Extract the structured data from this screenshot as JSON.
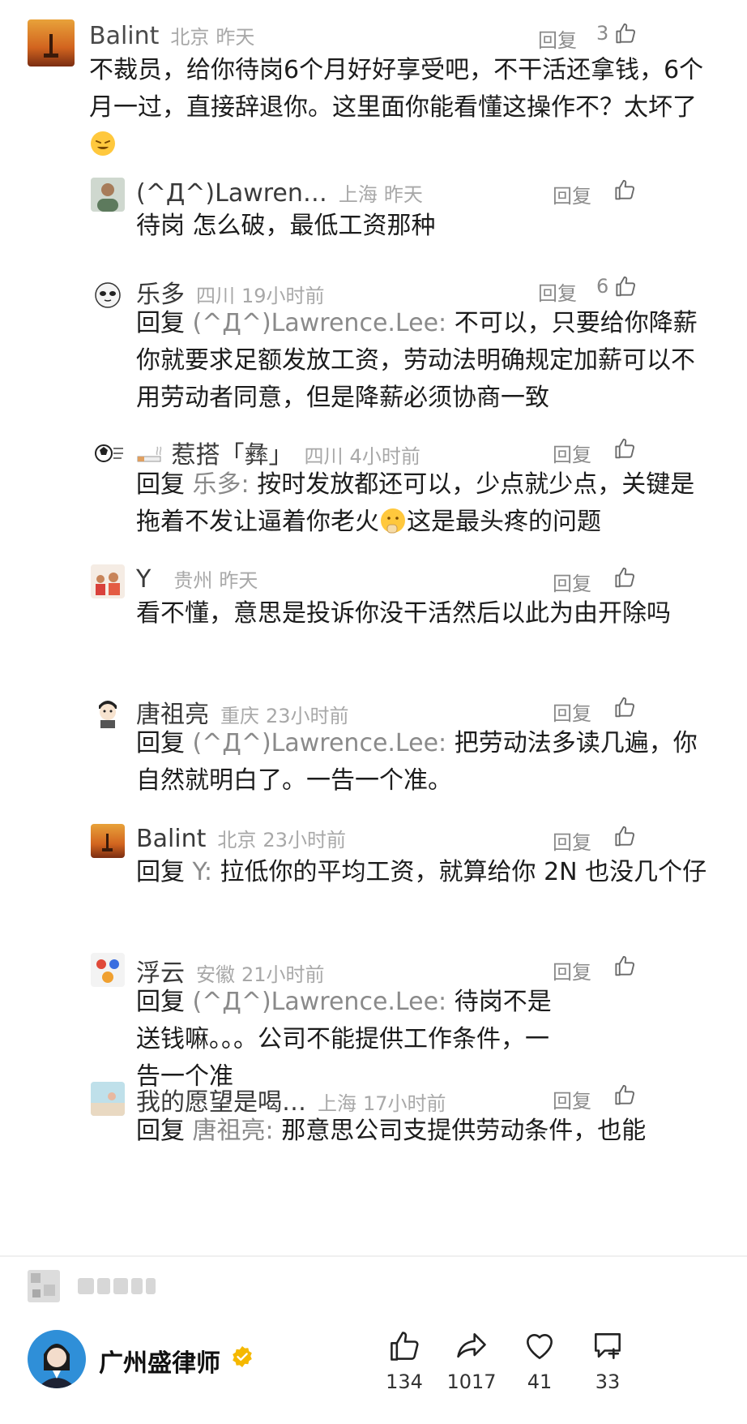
{
  "reply_label": "回复",
  "comments": [
    {
      "avatar": "sunset-avatar",
      "name": "Balint",
      "location": "北京",
      "time": "昨天",
      "likes": "3",
      "body": "不裁员，给你待岗6个月好好享受吧，不干活还拿钱，6个月一过，直接辞退你。这里面你能看懂这操作不？太坏了"
    },
    {
      "avatar": "person-avatar",
      "name": "(^Д^)Lawren…",
      "location": "上海",
      "time": "昨天",
      "likes": "",
      "body": "待岗 怎么破，最低工资那种"
    },
    {
      "avatar": "panda-avatar",
      "name": "乐多",
      "location": "四川",
      "time": "19小时前",
      "likes": "6",
      "reply_prefix": "回复",
      "reply_to": "(^Д^)Lawrence.Lee",
      "body": "不可以，只要给你降薪你就要求足额发放工资，劳动法明确规定加薪可以不用劳动者同意，但是降薪必须协商一致"
    },
    {
      "avatar": "ball-avatar",
      "name": "惹搭「彝」",
      "location": "四川",
      "time": "4小时前",
      "likes": "",
      "reply_prefix": "回复",
      "reply_to": "乐多",
      "body_a": "按时发放都还可以，少点就少点，关键是拖着不发让逼着你老火",
      "body_b": "这是最头疼的问题"
    },
    {
      "avatar": "family-avatar",
      "name": "Y",
      "location": "贵州",
      "time": "昨天",
      "likes": "",
      "body": "看不懂，意思是投诉你没干活然后以此为由开除吗"
    },
    {
      "avatar": "cartoon-avatar",
      "name": "唐祖亮",
      "location": "重庆",
      "time": "23小时前",
      "likes": "",
      "reply_prefix": "回复",
      "reply_to": "(^Д^)Lawrence.Lee",
      "body": "把劳动法多读几遍，你自然就明白了。一告一个准。"
    },
    {
      "avatar": "sunset-avatar",
      "name": "Balint",
      "location": "北京",
      "time": "23小时前",
      "likes": "",
      "reply_prefix": "回复",
      "reply_to": "Y",
      "body": "拉低你的平均工资，就算给你 2N 也没几个仔"
    },
    {
      "avatar": "sticker-avatar",
      "name": "浮云",
      "location": "安徽",
      "time": "21小时前",
      "likes": "",
      "reply_prefix": "回复",
      "reply_to": "(^Д^)Lawrence.Lee",
      "body": "待岗不是送钱嘛。。。公司不能提供工作条件，一告一个准"
    },
    {
      "avatar": "photo-avatar",
      "name": "我的愿望是喝…",
      "location": "上海",
      "time": "17小时前",
      "likes": "",
      "reply_prefix": "回复",
      "reply_to": "唐祖亮",
      "body": "那意思公司支提供劳动条件，也能"
    }
  ],
  "author": {
    "name": "广州盛律师"
  },
  "actions": [
    {
      "icon": "thumbs-up-icon",
      "count": "134"
    },
    {
      "icon": "share-icon",
      "count": "1017"
    },
    {
      "icon": "heart-icon",
      "count": "41"
    },
    {
      "icon": "comment-add-icon",
      "count": "33"
    }
  ]
}
